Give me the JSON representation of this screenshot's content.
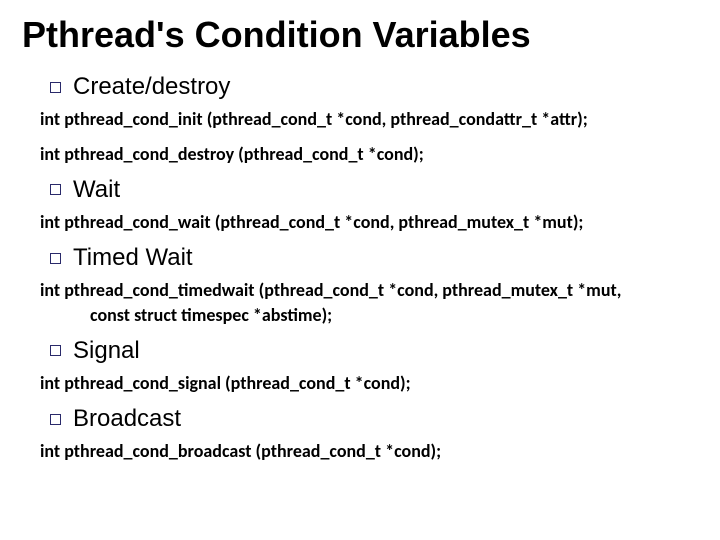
{
  "title": "Pthread's Condition Variables",
  "sections": {
    "create_destroy": {
      "label": "Create/destroy",
      "sig_init": "int pthread_cond_init (pthread_cond_t *cond, pthread_condattr_t *attr);",
      "sig_destroy": "int pthread_cond_destroy (pthread_cond_t *cond);"
    },
    "wait": {
      "label": "Wait",
      "sig": "int pthread_cond_wait (pthread_cond_t *cond, pthread_mutex_t *mut);"
    },
    "timed_wait": {
      "label": "Timed Wait",
      "sig_line1": "int pthread_cond_timedwait (pthread_cond_t *cond, pthread_mutex_t *mut,",
      "sig_line2": "const struct timespec *abstime);"
    },
    "signal": {
      "label": "Signal",
      "sig": "int pthread_cond_signal (pthread_cond_t *cond);"
    },
    "broadcast": {
      "label": "Broadcast",
      "sig": "int pthread_cond_broadcast (pthread_cond_t *cond);"
    }
  }
}
